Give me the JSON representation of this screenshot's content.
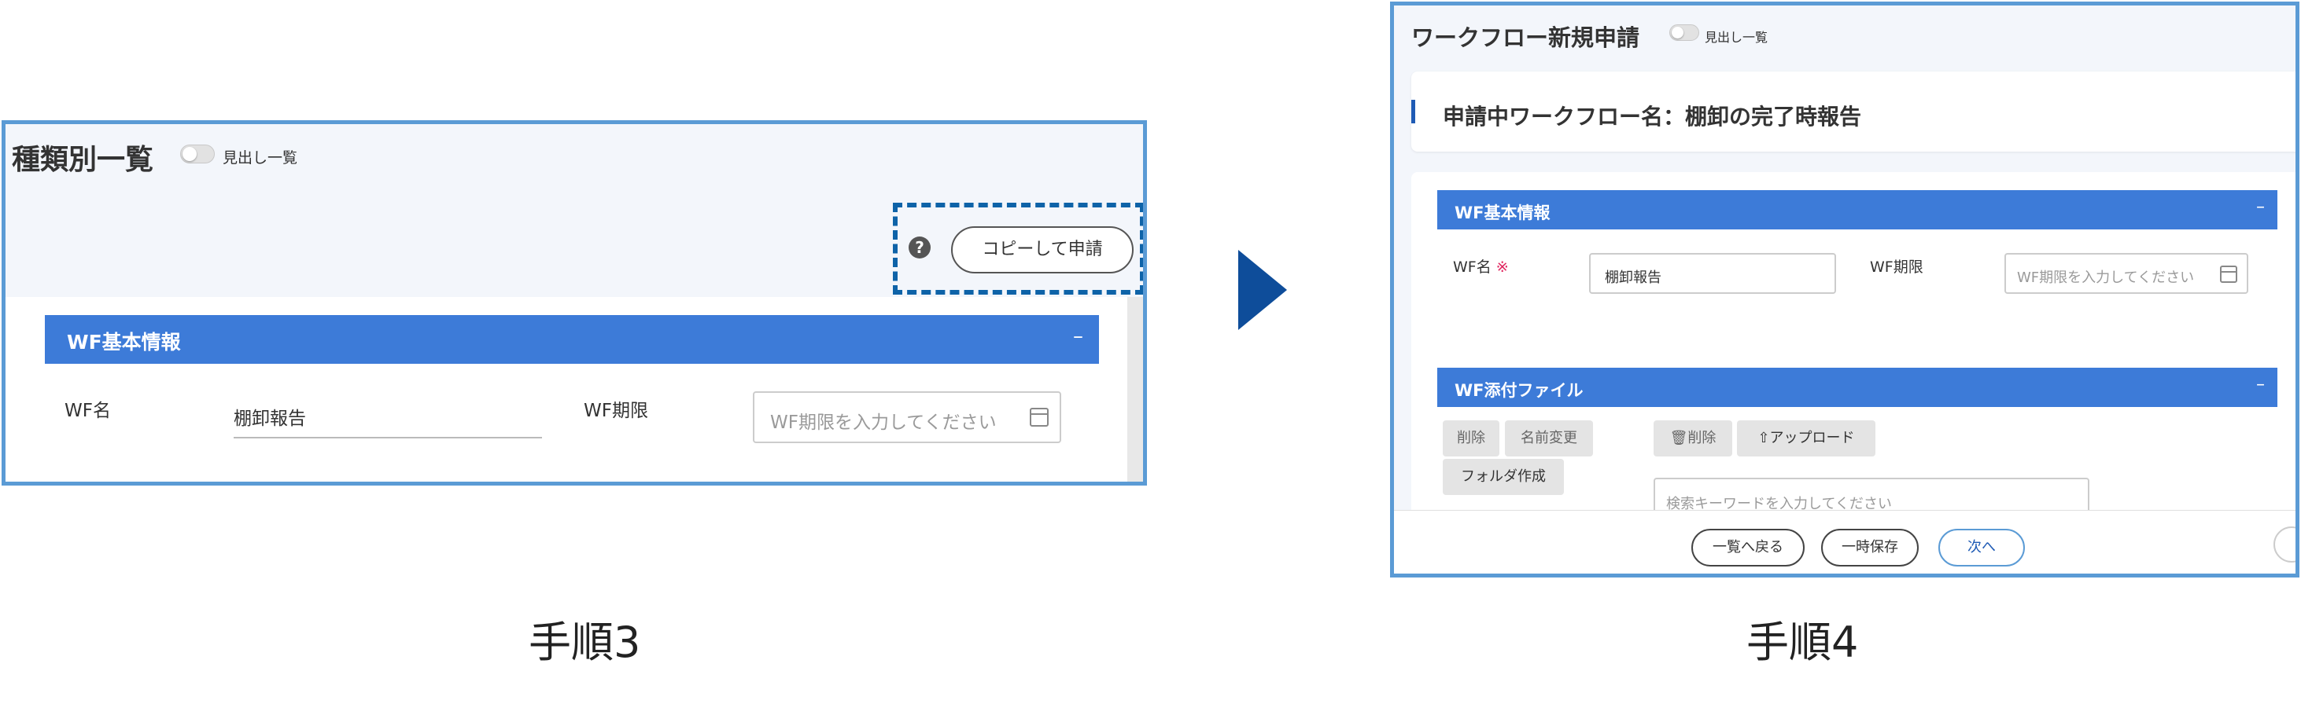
{
  "step3": {
    "caption": "手順3",
    "title": "種類別一覧",
    "toggle_label": "見出し一覧",
    "help_icon": "question-circle-icon",
    "copy_button": "コピーして申請",
    "section_title": "WF基本情報",
    "collapse_symbol": "–",
    "wf_name_label": "WF名",
    "wf_name_value": "棚卸報告",
    "wf_period_label": "WF期限",
    "wf_period_placeholder": "WF期限を入力してください"
  },
  "step4": {
    "caption": "手順4",
    "title": "ワークフロー新規申請",
    "toggle_label": "見出し一覧",
    "application_name": "申請中ワークフロー名：棚卸の完了時報告",
    "basic_section_title": "WF基本情報",
    "collapse_symbol": "–",
    "wf_name_label": "WF名",
    "required_mark": "※",
    "wf_name_value": "棚卸報告",
    "wf_period_label": "WF期限",
    "wf_period_placeholder": "WF期限を入力してください",
    "attachment_section_title": "WF添付ファイル",
    "buttons": {
      "delete": "削除",
      "rename": "名前変更",
      "create_folder": "フォルダ作成",
      "trash_delete": "削除",
      "upload": "アップロード"
    },
    "search_placeholder": "検索キーワードを入力してください",
    "footer": {
      "back": "一覧へ戻る",
      "save_draft": "一時保存",
      "next": "次へ"
    }
  },
  "colors": {
    "section_header": "#3d7bd8",
    "panel_border": "#5b9bd5",
    "highlight_dash": "#0e63a8",
    "arrow": "#0e4d9a",
    "required": "#e0245e"
  }
}
